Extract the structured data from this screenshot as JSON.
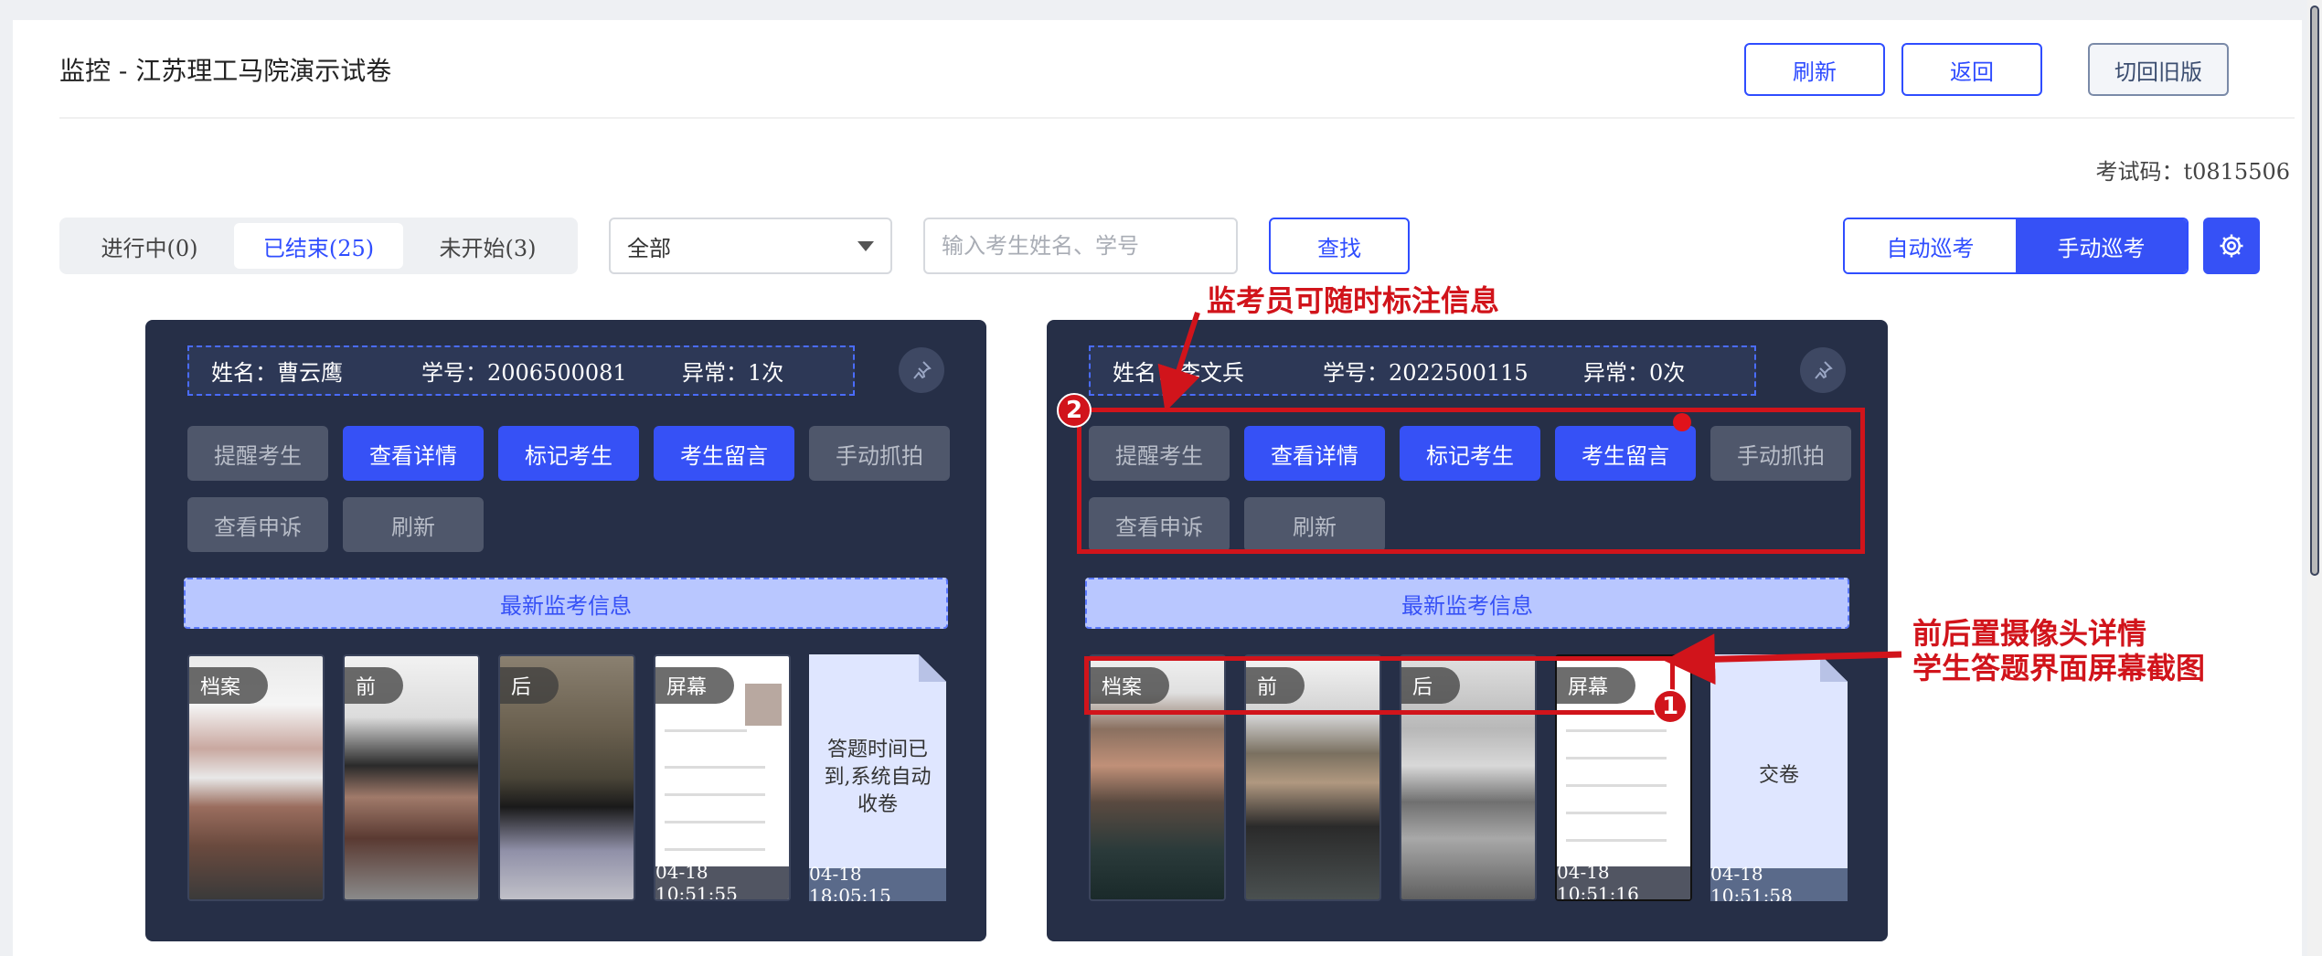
{
  "header": {
    "title": "监控 - 江苏理工马院演示试卷",
    "refresh_label": "刷新",
    "back_label": "返回",
    "old_version_label": "切回旧版",
    "exam_code": "考试码：t0815506"
  },
  "toolbar": {
    "tabs": [
      {
        "label": "进行中(0)",
        "active": false
      },
      {
        "label": "已结束(25)",
        "active": true
      },
      {
        "label": "未开始(3)",
        "active": false
      }
    ],
    "filter_value": "全部",
    "search_placeholder": "输入考生姓名、学号",
    "find_label": "查找",
    "auto_patrol": "自动巡考",
    "manual_patrol": "手动巡考",
    "settings_icon": "gear-icon"
  },
  "cards": [
    {
      "name": "姓名：曹云鹰",
      "student_id": "学号：2006500081",
      "abnormal": "异常：1次",
      "actions": [
        "提醒考生",
        "查看详情",
        "标记考生",
        "考生留言",
        "手动抓拍",
        "查看申诉",
        "刷新"
      ],
      "latest": "最新监考信息",
      "thumbs": [
        {
          "tag": "档案"
        },
        {
          "tag": "前"
        },
        {
          "tag": "后"
        },
        {
          "tag": "屏幕",
          "time": "04-18 10:51:55"
        }
      ],
      "doc": {
        "message": "答题时间已到,系统自动收卷",
        "time": "04-18 18:05:15"
      }
    },
    {
      "name": "姓名：李文兵",
      "student_id": "学号：2022500115",
      "abnormal": "异常：0次",
      "actions": [
        "提醒考生",
        "查看详情",
        "标记考生",
        "考生留言",
        "手动抓拍",
        "查看申诉",
        "刷新"
      ],
      "latest": "最新监考信息",
      "thumbs": [
        {
          "tag": "档案"
        },
        {
          "tag": "前"
        },
        {
          "tag": "后"
        },
        {
          "tag": "屏幕",
          "time": "04-18 10:51:16"
        }
      ],
      "doc": {
        "message": "交卷",
        "time": "04-18 10:51:58"
      }
    }
  ],
  "annotations": {
    "mark_info": "监考员可随时标注信息",
    "camera_detail_line1": "前后置摄像头详情",
    "camera_detail_line2": "学生答题界面屏幕截图",
    "badge1": "1",
    "badge2": "2",
    "color": "#d1141b"
  }
}
